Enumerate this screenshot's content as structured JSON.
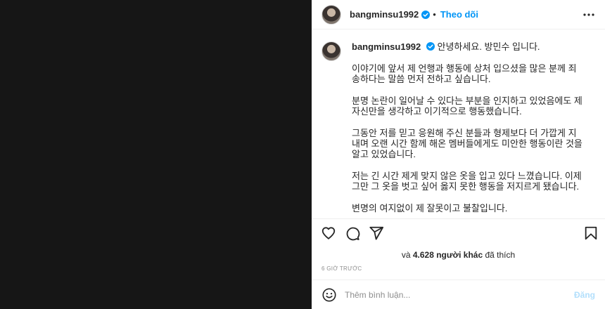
{
  "post": {
    "username": "bangminsu1992",
    "separator": "•",
    "follow_label": "Theo dõi"
  },
  "caption": {
    "username": "bangminsu1992",
    "greeting": "안녕하세요. 방민수 입니다.",
    "paragraphs": [
      "이야기에 앞서 제 언행과 행동에 상처 입으셨을 많은 분께 죄송하다는 말씀 먼저 전하고 싶습니다.",
      "분명 논란이 일어날 수 있다는 부분을 인지하고 있었음에도 제 자신만을 생각하고 이기적으로 행동했습니다.",
      "그동안 저를 믿고 응원해 주신 분들과 형제보다 더 가깝게 지내며 오랜 시간 함께 해온 멤버들에게도 미안한 행동이란 것을 알고 있었습니다.",
      "저는 긴 시간 제게 맞지 않은 옷을 입고 있다 느꼈습니다. 이제 그만 그 옷을 벗고 싶어 옳지 못한 행동을 저지르게 됐습니다.",
      "변명의 여지없이 제 잘못이고 불찰입니다."
    ]
  },
  "likes": {
    "prefix": "và",
    "count": "4.628",
    "suffix": "người khác",
    "tail": "đã thích"
  },
  "timestamp": "6 GIỜ TRƯỚC",
  "comment": {
    "placeholder": "Thêm bình luận...",
    "post_label": "Đăng"
  },
  "icons": {
    "verified": "verified-badge-icon",
    "more": "more-options-icon",
    "like": "heart-icon",
    "comment": "comment-icon",
    "share": "share-icon",
    "save": "bookmark-icon",
    "emoji": "emoji-icon"
  },
  "colors": {
    "accent": "#0095f6",
    "post_disabled": "#b2dffc",
    "media_bg": "#161616"
  }
}
